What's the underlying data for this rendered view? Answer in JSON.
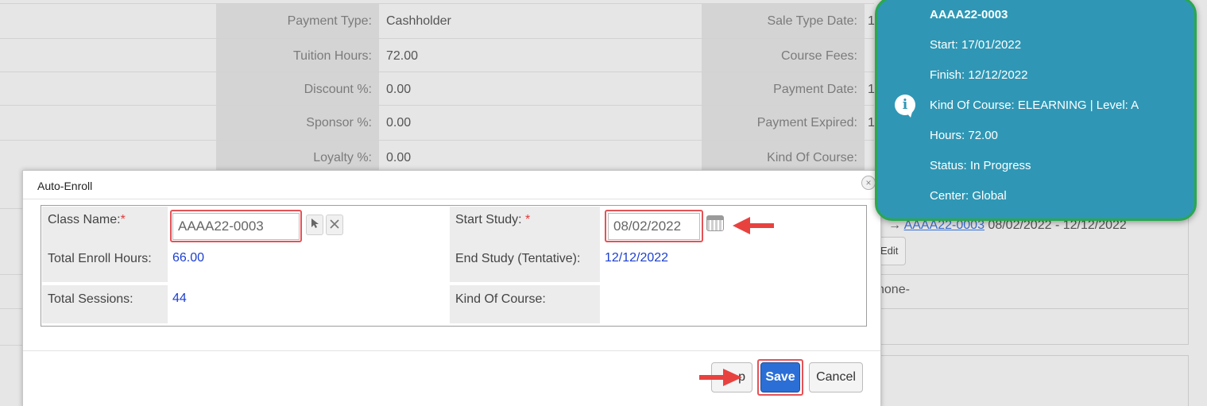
{
  "background": {
    "rows": [
      {
        "label": "Payment Type:",
        "value": "Cashholder",
        "label2": "Sale Type Date:",
        "value2": "1"
      },
      {
        "label": "Tuition Hours:",
        "value": "72.00",
        "label2": "Course Fees:",
        "value2": ""
      },
      {
        "label": "Discount %:",
        "value": "0.00",
        "label2": "Payment Date:",
        "value2": "1"
      },
      {
        "label": "Sponsor %:",
        "value": "0.00",
        "label2": "Payment Expired:",
        "value2": "1"
      },
      {
        "label": "Loyalty %:",
        "value": "0.00",
        "label2": "Kind Of Course:",
        "value2": ""
      }
    ],
    "right_link_arrow": "→",
    "right_link_text": "AAAA22-0003",
    "right_link_dates": "08/02/2022 - 12/12/2022",
    "edit_label": "Edit",
    "none_text": "none-"
  },
  "dialog": {
    "title": "Auto-Enroll",
    "close_symbol": "×",
    "class_name_label": "Class Name:",
    "class_name_value": "AAAA22-0003",
    "start_study_label": "Start Study:",
    "start_study_value": "08/02/2022",
    "required_mark": "*",
    "total_enroll_hours_label": "Total Enroll Hours:",
    "total_enroll_hours_value": "66.00",
    "end_study_label": "End Study (Tentative):",
    "end_study_value": "12/12/2022",
    "total_sessions_label": "Total Sessions:",
    "total_sessions_value": "44",
    "kind_of_course_label": "Kind Of Course:",
    "kind_of_course_value": "",
    "footer": {
      "partial_button_label": "p",
      "save_label": "Save",
      "cancel_label": "Cancel"
    }
  },
  "tooltip": {
    "title": "AAAA22-0003",
    "start": "Start: 17/01/2022",
    "finish": "Finish: 12/12/2022",
    "kind": "Kind Of Course: ELEARNING | Level: A",
    "hours": "Hours: 72.00",
    "status": "Status: In Progress",
    "center": "Center: Global",
    "icon_letter": "i"
  },
  "colors": {
    "accent_blue": "#2b6fd6",
    "tooltip_bg": "#2f97b5",
    "tooltip_border": "#2aa84d",
    "highlight_red": "#e55256",
    "value_blue": "#1c3fcf"
  }
}
